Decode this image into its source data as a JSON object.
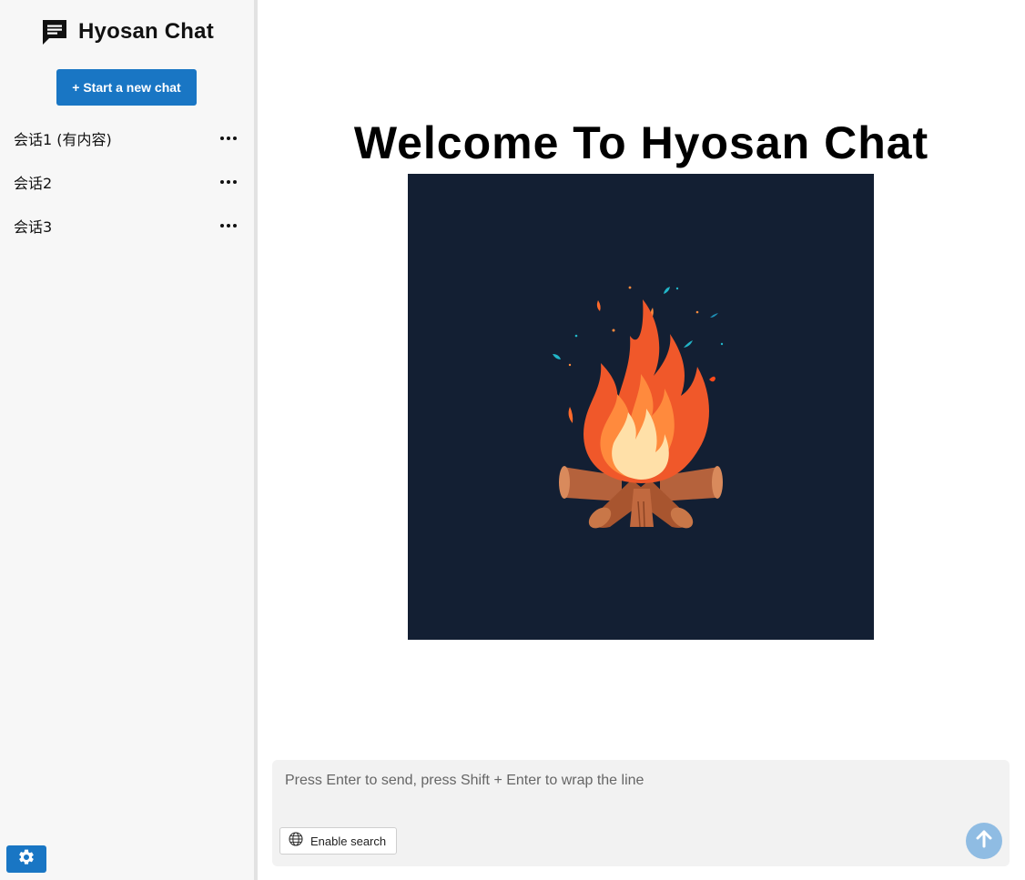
{
  "sidebar": {
    "brand_icon": "chat-bubble-icon",
    "brand_title": "Hyosan Chat",
    "new_chat_label": "+ Start a new chat",
    "chats": [
      {
        "label": "会话1 (有内容)",
        "more_icon": "more-horizontal-icon"
      },
      {
        "label": "会话2",
        "more_icon": "more-horizontal-icon"
      },
      {
        "label": "会话3",
        "more_icon": "more-horizontal-icon"
      }
    ],
    "settings_icon": "gear-icon"
  },
  "main": {
    "welcome_title": "Welcome To Hyosan Chat",
    "hero_image": "campfire-illustration"
  },
  "composer": {
    "placeholder": "Press Enter to send, press Shift + Enter to wrap the line",
    "value": "",
    "search_toggle_label": "Enable search",
    "search_icon": "globe-icon",
    "send_icon": "arrow-up-icon"
  },
  "colors": {
    "accent": "#1976c4",
    "send_disabled": "#8fbce3",
    "hero_bg": "#131f33",
    "sidebar_bg": "#f7f7f7"
  }
}
